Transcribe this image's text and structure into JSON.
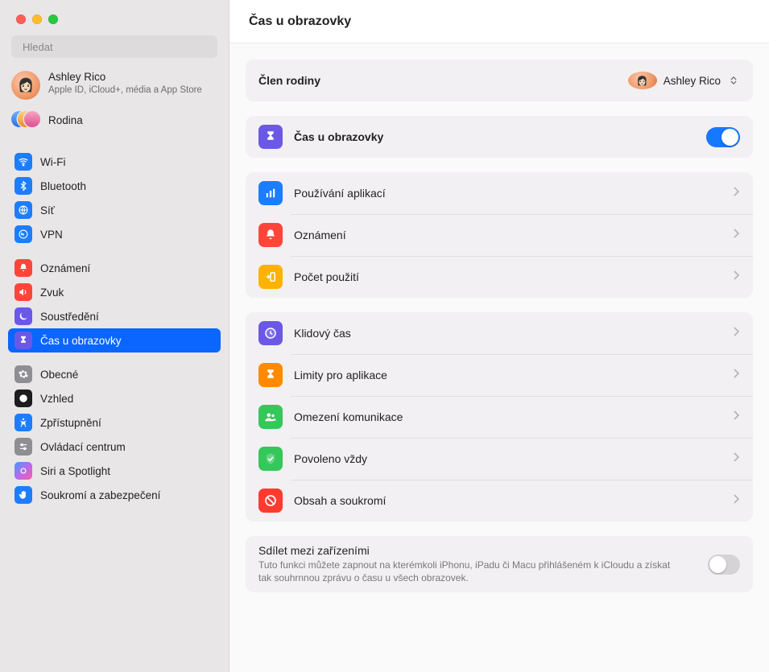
{
  "window": {
    "title": "Čas u obrazovky"
  },
  "search": {
    "placeholder": "Hledat"
  },
  "account": {
    "name": "Ashley Rico",
    "subtitle": "Apple ID, iCloud+, média a App Store"
  },
  "family": {
    "label": "Rodina"
  },
  "sidebar": {
    "g1": {
      "wifi": "Wi-Fi",
      "bluetooth": "Bluetooth",
      "network": "Síť",
      "vpn": "VPN"
    },
    "g2": {
      "notifications": "Oznámení",
      "sound": "Zvuk",
      "focus": "Soustředění",
      "screentime": "Čas u obrazovky"
    },
    "g3": {
      "general": "Obecné",
      "appearance": "Vzhled",
      "accessibility": "Zpřístupnění",
      "controlcenter": "Ovládací centrum",
      "siri": "Siri a Spotlight",
      "privacy": "Soukromí a zabezpečení"
    }
  },
  "main": {
    "family_member_label": "Člen rodiny",
    "family_member_value": "Ashley Rico",
    "screentime_toggle_label": "Čas u obrazovky",
    "rows": {
      "usage": "Používání aplikací",
      "notifications": "Oznámení",
      "pickups": "Počet použití",
      "downtime": "Klidový čas",
      "applimits": "Limity pro aplikace",
      "communication": "Omezení komunikace",
      "always": "Povoleno vždy",
      "content": "Obsah a soukromí"
    },
    "share": {
      "title": "Sdílet mezi zařízeními",
      "subtitle": "Tuto funkci můžete zapnout na kterémkoli iPhonu, iPadu či Macu přihlášeném k iCloudu a získat tak souhrnnou zprávu o času u všech obrazovek."
    }
  }
}
